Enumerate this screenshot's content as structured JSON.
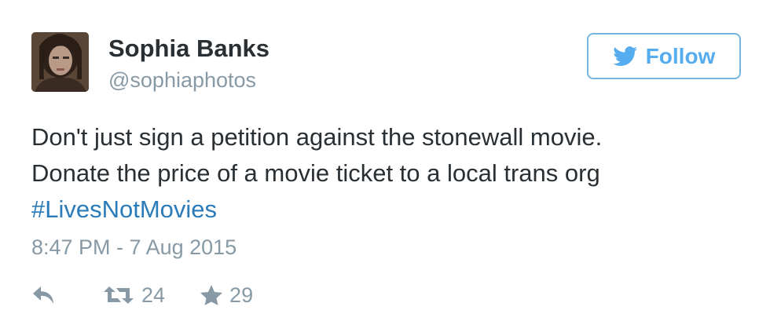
{
  "user": {
    "name": "Sophia Banks",
    "handle": "@sophiaphotos"
  },
  "follow_button": {
    "label": "Follow"
  },
  "tweet": {
    "lines": [
      "Don't just sign a petition against the stonewall movie.",
      "Donate the price of a movie ticket to a local trans org"
    ],
    "hashtag": "#LivesNotMovies",
    "timestamp": "8:47 PM - 7 Aug 2015"
  },
  "actions": {
    "reply_icon": "reply-arrow-icon",
    "retweet_icon": "retweet-icon",
    "retweet_count": "24",
    "favorite_icon": "star-icon",
    "favorite_count": "29"
  },
  "colors": {
    "accent": "#55acee",
    "hashtag": "#2b7bb9",
    "text": "#292f33",
    "muted": "#8899a6"
  }
}
